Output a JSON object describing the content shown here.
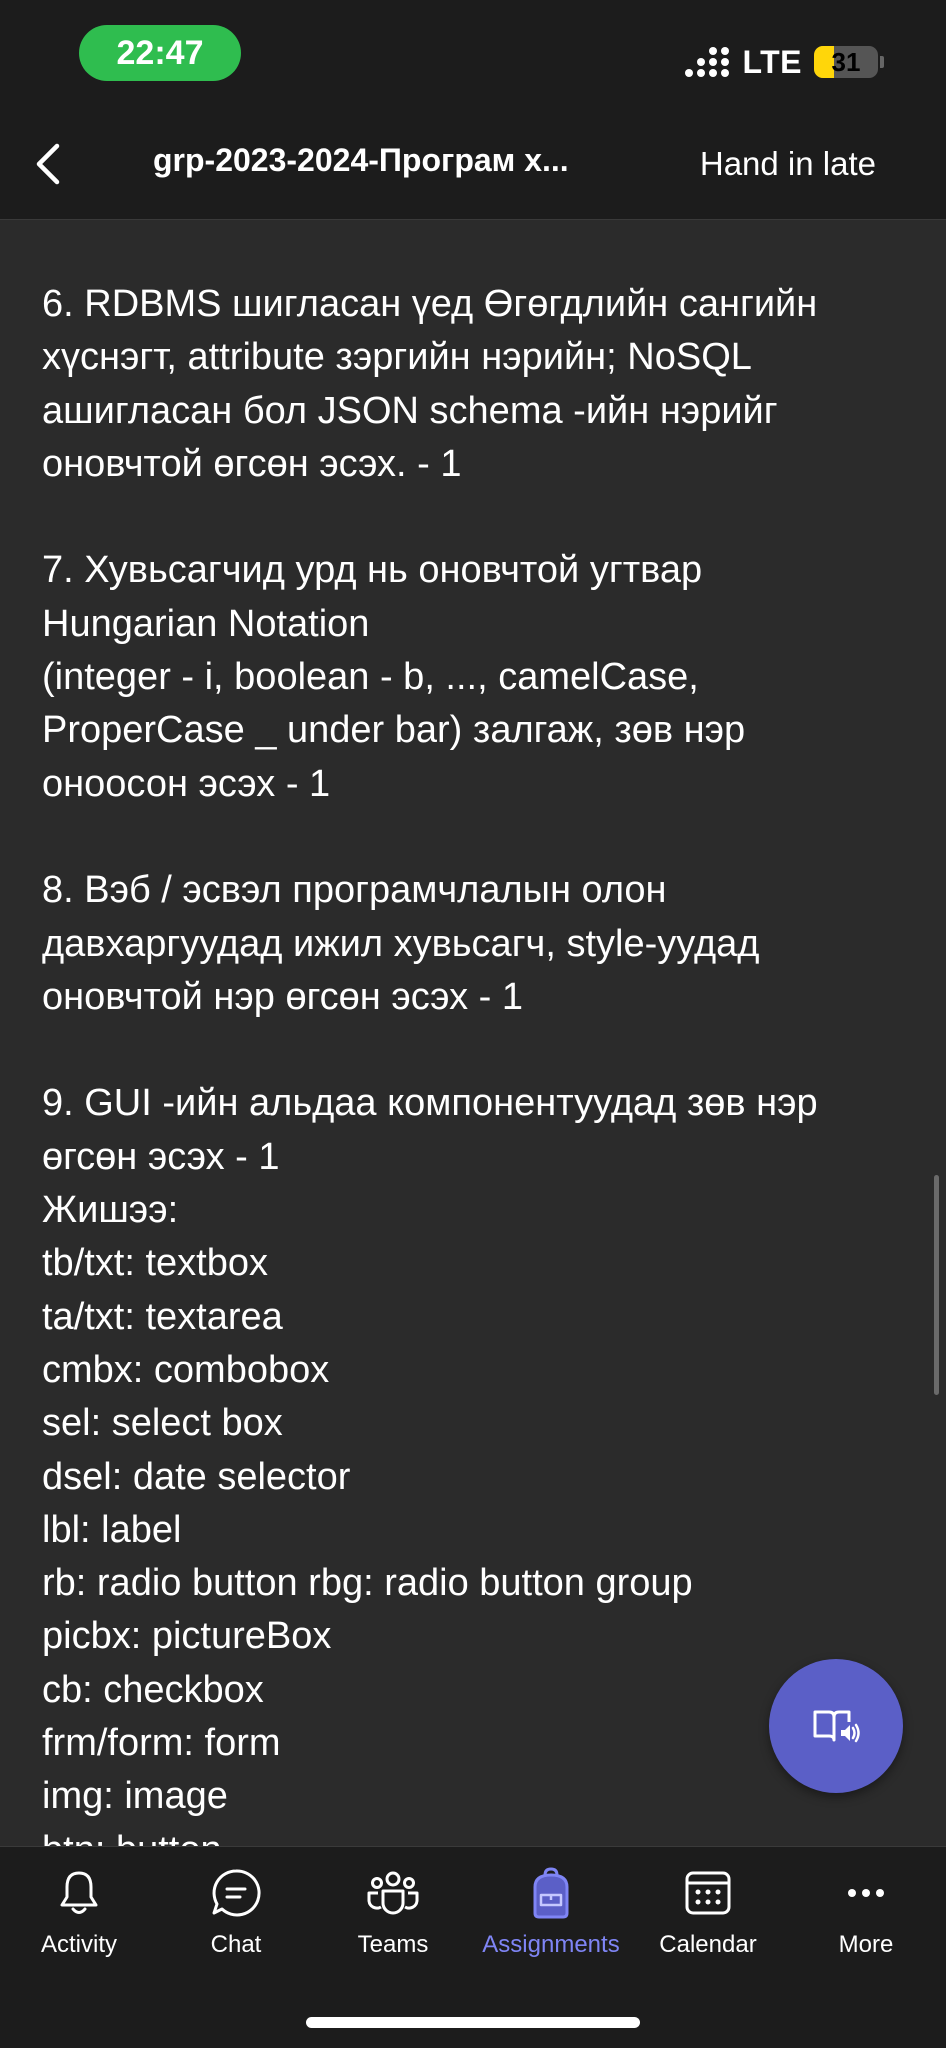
{
  "status_bar": {
    "time": "22:47",
    "network": "LTE",
    "battery": "31",
    "battery_level_percent": 31,
    "battery_color": "#ffd60a",
    "time_pill_color": "#2fbd4f"
  },
  "header": {
    "title": "grp-2023-2024-Програм х...",
    "action_label": "Hand in late",
    "back_icon": "chevron-left-icon"
  },
  "content": {
    "paragraphs": [
      {
        "lines": [
          "6. RDBMS шигласан үед Өгөгдлийн сангийн",
          "хүснэгт, attribute зэргийн нэрийн; NoSQL",
          "ашигласан бол JSON schema -ийн нэрийг",
          "оновчтой өгсөн эсэх. - 1"
        ]
      },
      {
        "lines": [
          "7. Хувьсагчид урд нь оновчтой угтвар",
          "Hungarian Notation",
          "(integer - i, boolean - b, ..., camelCase,",
          "ProperCase _ under bar) залгаж, зөв нэр",
          "оноосон эсэх - 1"
        ]
      },
      {
        "lines": [
          "8. Вэб / эсвэл програмчлалын олон",
          "давхаргуудад ижил хувьсагч, style-уудад",
          "оновчтой нэр өгсөн эсэх - 1"
        ]
      },
      {
        "lines": [
          "9. GUI -ийн альдаа компонентуудад зөв нэр",
          "өгсөн эсэх - 1",
          "Жишээ:",
          "tb/txt: textbox",
          "ta/txt: textarea",
          "cmbx: combobox",
          "sel: select box",
          "dsel: date selector",
          "lbl: label",
          "rb: radio button rbg: radio button group",
          "picbx: pictureBox",
          "cb: checkbox",
          "frm/form: form",
          "img: image",
          "btn: button"
        ]
      }
    ]
  },
  "fab": {
    "icon": "immersive-reader-icon",
    "color": "#5b5fc7"
  },
  "tabbar": {
    "active_color": "#7f85f5",
    "tabs": [
      {
        "label": "Activity",
        "icon": "bell-icon",
        "active": false
      },
      {
        "label": "Chat",
        "icon": "chat-icon",
        "active": false
      },
      {
        "label": "Teams",
        "icon": "teams-icon",
        "active": false
      },
      {
        "label": "Assignments",
        "icon": "backpack-icon",
        "active": true
      },
      {
        "label": "Calendar",
        "icon": "calendar-icon",
        "active": false
      },
      {
        "label": "More",
        "icon": "more-icon",
        "active": false
      }
    ]
  }
}
